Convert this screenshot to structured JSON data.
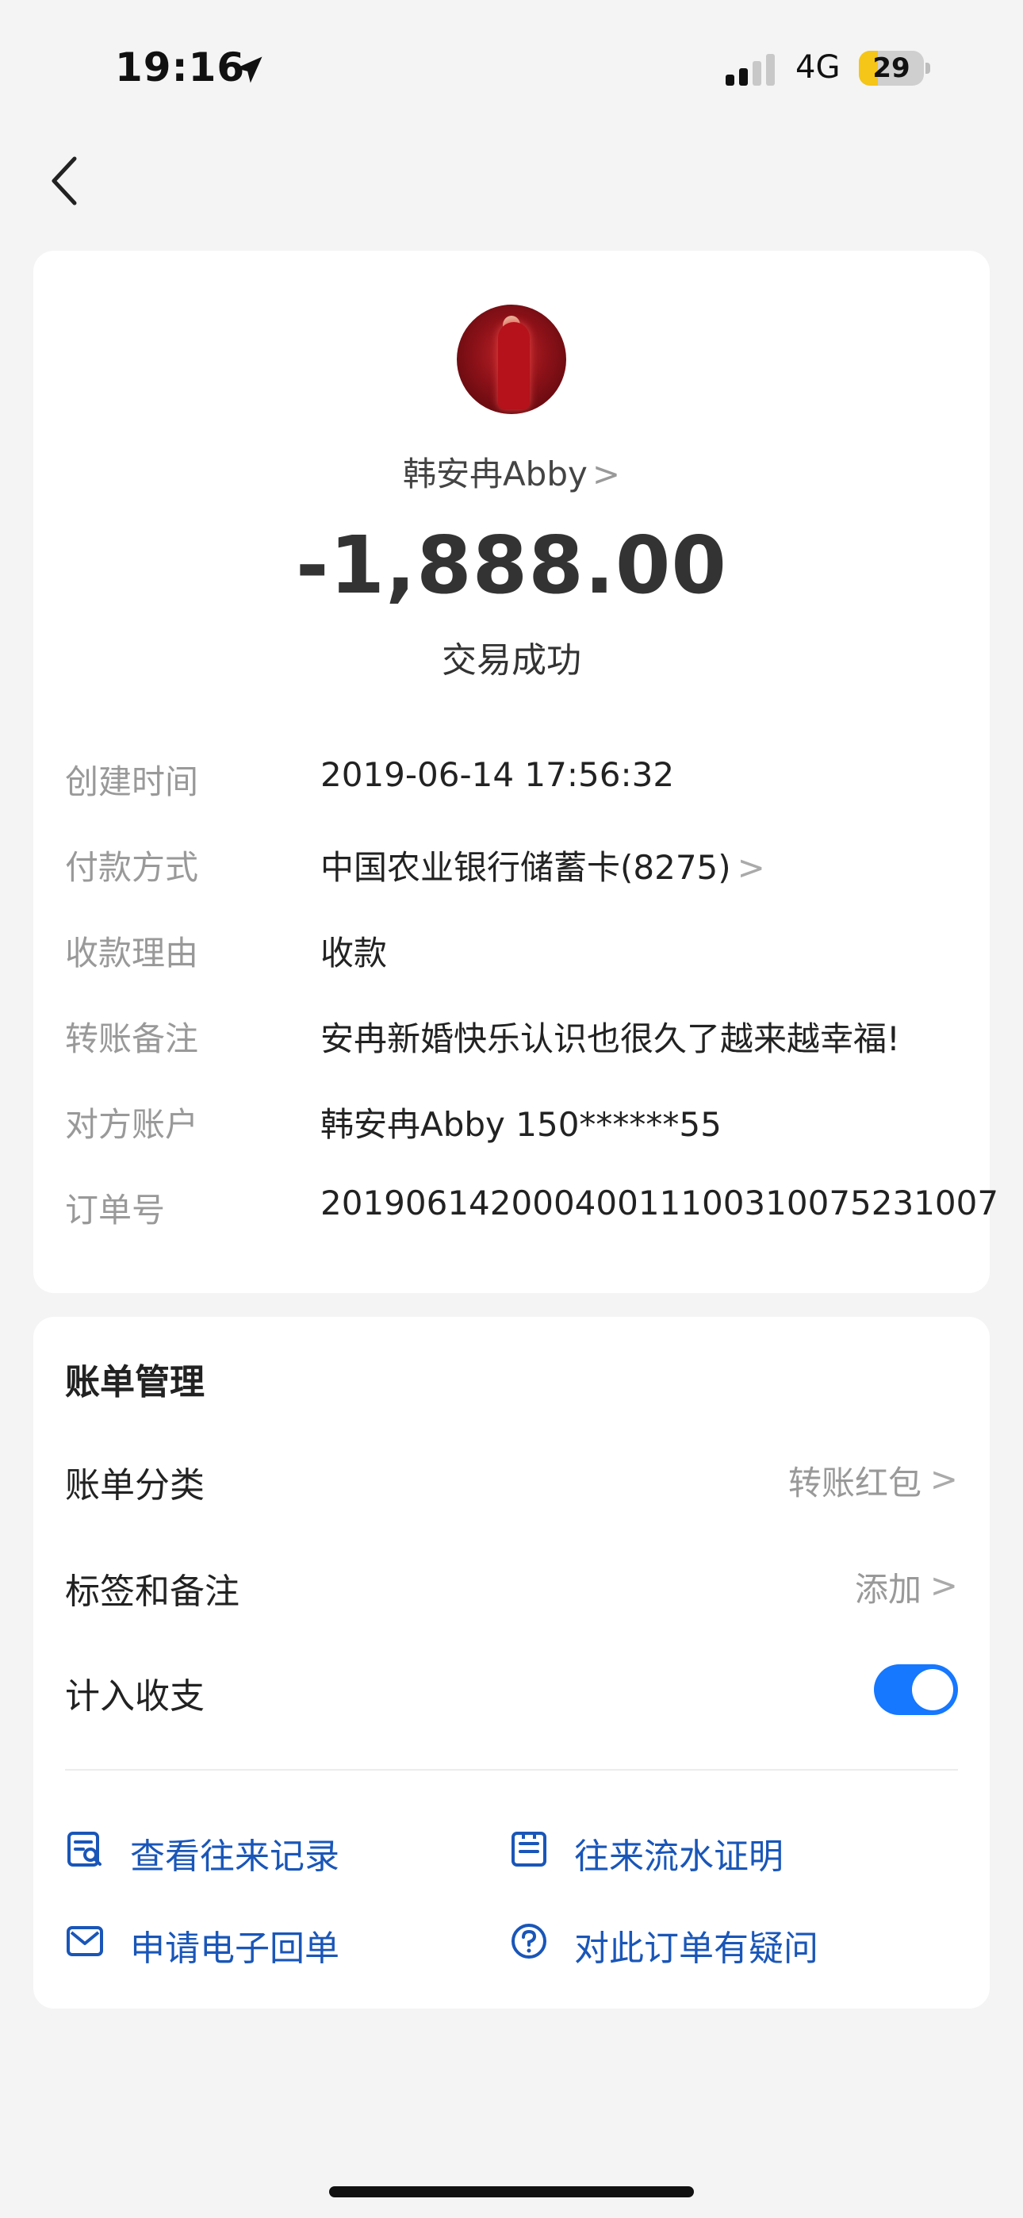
{
  "status_bar": {
    "time": "19:16",
    "network": "4G",
    "battery_level": "29",
    "battery_fraction": 0.29,
    "battery_color": "#f5c518",
    "icons": [
      "location-arrow-icon",
      "signal-icon",
      "battery-icon"
    ]
  },
  "nav": {
    "back_icon": "chevron-left-icon"
  },
  "transaction": {
    "payee_name": "韩安冉Abby",
    "payee_chevron": ">",
    "amount": "-1,888.00",
    "status": "交易成功",
    "details": [
      {
        "label": "创建时间",
        "value": "2019-06-14 17:56:32"
      },
      {
        "label": "付款方式",
        "value": "中国农业银行储蓄卡(8275)",
        "chevron": ">"
      },
      {
        "label": "收款理由",
        "value": "收款"
      },
      {
        "label": "转账备注",
        "value": "安冉新婚快乐认识也很久了越来越幸福!"
      },
      {
        "label": "对方账户",
        "value": "韩安冉Abby 150******55"
      },
      {
        "label": "订单号",
        "value": "20190614200040011100310075231007"
      }
    ]
  },
  "bill_management": {
    "title": "账单管理",
    "category_label": "账单分类",
    "category_value": "转账红包",
    "tags_label": "标签和备注",
    "tags_value": "添加",
    "include_label": "计入收支",
    "include_enabled": true,
    "chevron": ">",
    "accent_color": "#1677ff",
    "actions": [
      {
        "label": "查看往来记录",
        "icon": "search-document-icon"
      },
      {
        "label": "往来流水证明",
        "icon": "document-icon"
      },
      {
        "label": "申请电子回单",
        "icon": "mail-icon"
      },
      {
        "label": "对此订单有疑问",
        "icon": "question-circle-icon"
      }
    ]
  }
}
